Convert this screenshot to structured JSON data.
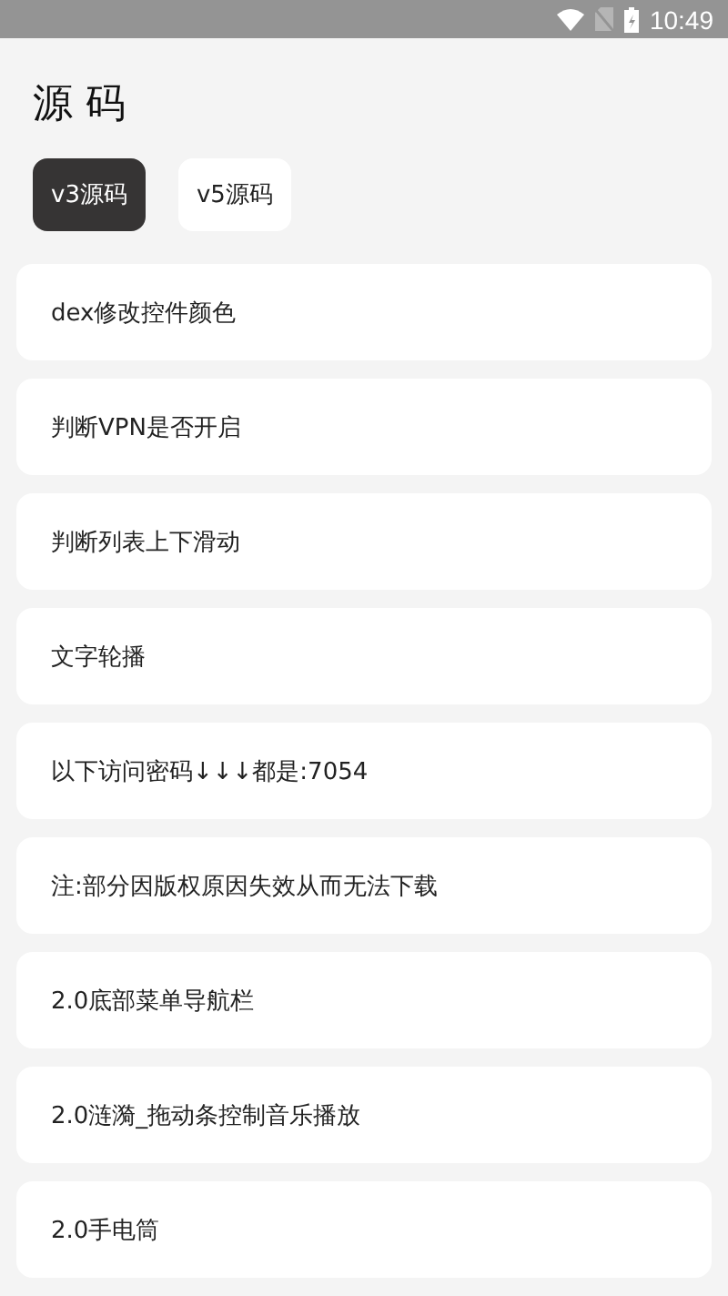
{
  "status_bar": {
    "time": "10:49"
  },
  "title": "源 码",
  "tabs": [
    {
      "label": "v3源码",
      "selected": true
    },
    {
      "label": "v5源码",
      "selected": false
    }
  ],
  "items": [
    "dex修改控件颜色",
    "判断VPN是否开启",
    "判断列表上下滑动",
    "文字轮播",
    "以下访问密码↓↓↓都是:7054",
    "注:部分因版权原因失效从而无法下载",
    "2.0底部菜单导航栏",
    "2.0涟漪_拖动条控制音乐播放",
    "2.0手电筒"
  ]
}
